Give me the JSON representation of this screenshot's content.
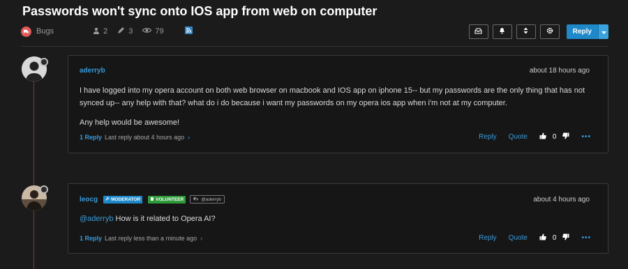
{
  "topic": {
    "title": "Passwords won't sync onto IOS app from web on computer",
    "category": "Bugs",
    "posters_count": "2",
    "posts_count": "3",
    "views_count": "79"
  },
  "toolbar": {
    "reply_label": "Reply",
    "icons": [
      "inbox-icon",
      "bell-icon",
      "sort-icon",
      "gear-icon"
    ]
  },
  "posts": [
    {
      "author": "aderryb",
      "time": "about 18 hours ago",
      "body": [
        "I have logged into my opera account on both web browser on macbook and IOS app on iphone 15-- but my passwords are the only thing that has not synced up-- any help with that? what do i do because i want my passwords on my opera ios app when i'm not at my computer.",
        "Any help would be awesome!"
      ],
      "replies_link": "1 Reply",
      "last_reply": "Last reply about 4 hours ago",
      "reply_label": "Reply",
      "quote_label": "Quote",
      "votes": "0"
    },
    {
      "author": "leocg",
      "badges": [
        "MODERATOR",
        "VOLUNTEER"
      ],
      "reply_to": "@aderryb",
      "time": "about 4 hours ago",
      "mention": "@aderryb",
      "body_text": " How is it related to Opera AI?",
      "replies_link": "1 Reply",
      "last_reply": "Last reply less than a minute ago",
      "reply_label": "Reply",
      "quote_label": "Quote",
      "votes": "0"
    }
  ],
  "colors": {
    "accent": "#3a9ad9",
    "primary_button": "#1e88c9",
    "category": "#e05a5a",
    "moderator_badge": "#1e88c9",
    "volunteer_badge": "#2e9a3a",
    "background": "#1b1b1c"
  }
}
